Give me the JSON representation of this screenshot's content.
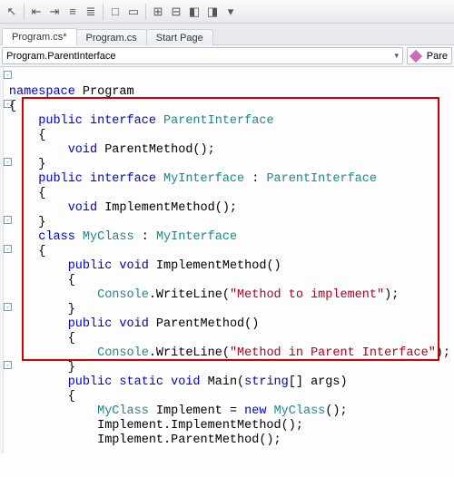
{
  "toolbar": {
    "icons": [
      {
        "name": "cursor-icon",
        "glyph": "↖"
      },
      {
        "name": "sep"
      },
      {
        "name": "outdent-icon",
        "glyph": "⇤"
      },
      {
        "name": "indent-icon",
        "glyph": "⇥"
      },
      {
        "name": "dedent-block-icon",
        "glyph": "≡"
      },
      {
        "name": "indent-block-icon",
        "glyph": "≣"
      },
      {
        "name": "sep"
      },
      {
        "name": "comment-icon",
        "glyph": "□"
      },
      {
        "name": "uncomment-icon",
        "glyph": "▭"
      },
      {
        "name": "sep"
      },
      {
        "name": "expand-icon",
        "glyph": "⊞"
      },
      {
        "name": "collapse-icon",
        "glyph": "⊟"
      },
      {
        "name": "bookmark-icon",
        "glyph": "◧"
      },
      {
        "name": "next-bookmark-icon",
        "glyph": "◨"
      },
      {
        "name": "more-icon",
        "glyph": "▾"
      }
    ]
  },
  "tabs": [
    {
      "label": "Program.cs*",
      "active": true
    },
    {
      "label": "Program.cs",
      "active": false
    },
    {
      "label": "Start Page",
      "active": false
    }
  ],
  "nav": {
    "left": "Program.ParentInterface",
    "right": "Pare"
  },
  "code": {
    "l1a": "namespace",
    "l1b": " Program",
    "l2": "{",
    "l3a": "    public",
    "l3b": " interface",
    "l3c": " ParentInterface",
    "l4": "    {",
    "l5a": "        void",
    "l5b": " ParentMethod();",
    "l6": "    }",
    "l7a": "    public",
    "l7b": " interface",
    "l7c": " MyInterface",
    "l7d": " : ",
    "l7e": "ParentInterface",
    "l8": "    {",
    "l9a": "        void",
    "l9b": " ImplementMethod();",
    "l10": "    }",
    "l11a": "    class",
    "l11b": " MyClass",
    "l11c": " : ",
    "l11d": "MyInterface",
    "l12": "    {",
    "l13a": "        public",
    "l13b": " void",
    "l13c": " ImplementMethod()",
    "l14": "        {",
    "l15a": "            Console",
    "l15b": ".WriteLine(",
    "l15c": "\"Method to implement\"",
    "l15d": ");",
    "l16": "        }",
    "l17a": "        public",
    "l17b": " void",
    "l17c": " ParentMethod()",
    "l18": "        {",
    "l19a": "            Console",
    "l19b": ".WriteLine(",
    "l19c": "\"Method in Parent Interface\"",
    "l19d": ");",
    "l20": "        }",
    "l21a": "        public",
    "l21b": " static",
    "l21c": " void",
    "l21d": " Main(",
    "l21e": "string",
    "l21f": "[] args)",
    "l22": "        {",
    "l23a": "            MyClass",
    "l23b": " Implement = ",
    "l23c": "new",
    "l23d": " ",
    "l23e": "MyClass",
    "l23f": "();",
    "l24": "            Implement.ImplementMethod();",
    "l25": "            Implement.ParentMethod();"
  }
}
